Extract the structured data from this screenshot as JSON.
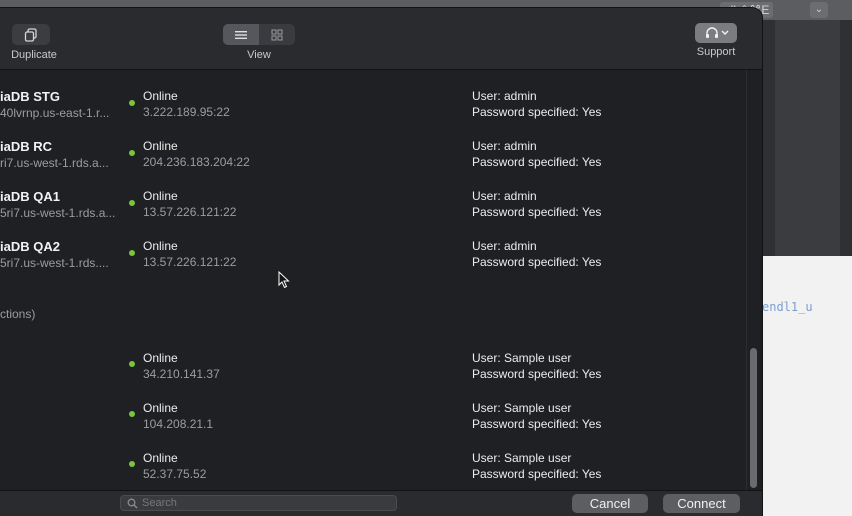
{
  "toolbar": {
    "duplicate_label": "Duplicate",
    "view_label": "View",
    "support_label": "Support",
    "view_modes": [
      "list-icon",
      "grid-icon"
    ],
    "active_view": "list-icon"
  },
  "background": {
    "shortcut": "oll ⇧⌘E",
    "link_text": "endl1_u"
  },
  "connections": [
    {
      "name": "iaDB STG",
      "host": "40lvrnp.us-east-1.r...",
      "status": "Online",
      "address": "3.222.189.95:22",
      "user": "User: admin",
      "password": "Password specified: Yes"
    },
    {
      "name": "iaDB RC",
      "host": "ri7.us-west-1.rds.a...",
      "status": "Online",
      "address": "204.236.183.204:22",
      "user": "User: admin",
      "password": "Password specified: Yes"
    },
    {
      "name": "iaDB QA1",
      "host": "5ri7.us-west-1.rds.a...",
      "status": "Online",
      "address": "13.57.226.121:22",
      "user": "User: admin",
      "password": "Password specified: Yes"
    },
    {
      "name": "iaDB QA2",
      "host": "5ri7.us-west-1.rds....",
      "status": "Online",
      "address": "13.57.226.121:22",
      "user": "User: admin",
      "password": "Password specified: Yes"
    },
    {
      "name": "",
      "host": "",
      "status": "Online",
      "address": "34.210.141.37",
      "user": "User: Sample user",
      "password": "Password specified: Yes"
    },
    {
      "name": "",
      "host": "",
      "status": "Online",
      "address": "104.208.21.1",
      "user": "User: Sample user",
      "password": "Password specified: Yes"
    },
    {
      "name": "",
      "host": "",
      "status": "Online",
      "address": "52.37.75.52",
      "user": "User: Sample user",
      "password": "Password specified: Yes"
    }
  ],
  "group_label": "ctions)",
  "footer": {
    "search_placeholder": "Search",
    "cancel_label": "Cancel",
    "connect_label": "Connect"
  },
  "colors": {
    "online": "#7cc43c",
    "dialog_bg": "#1f2023",
    "toolbar_bg": "#2a2b2e"
  }
}
